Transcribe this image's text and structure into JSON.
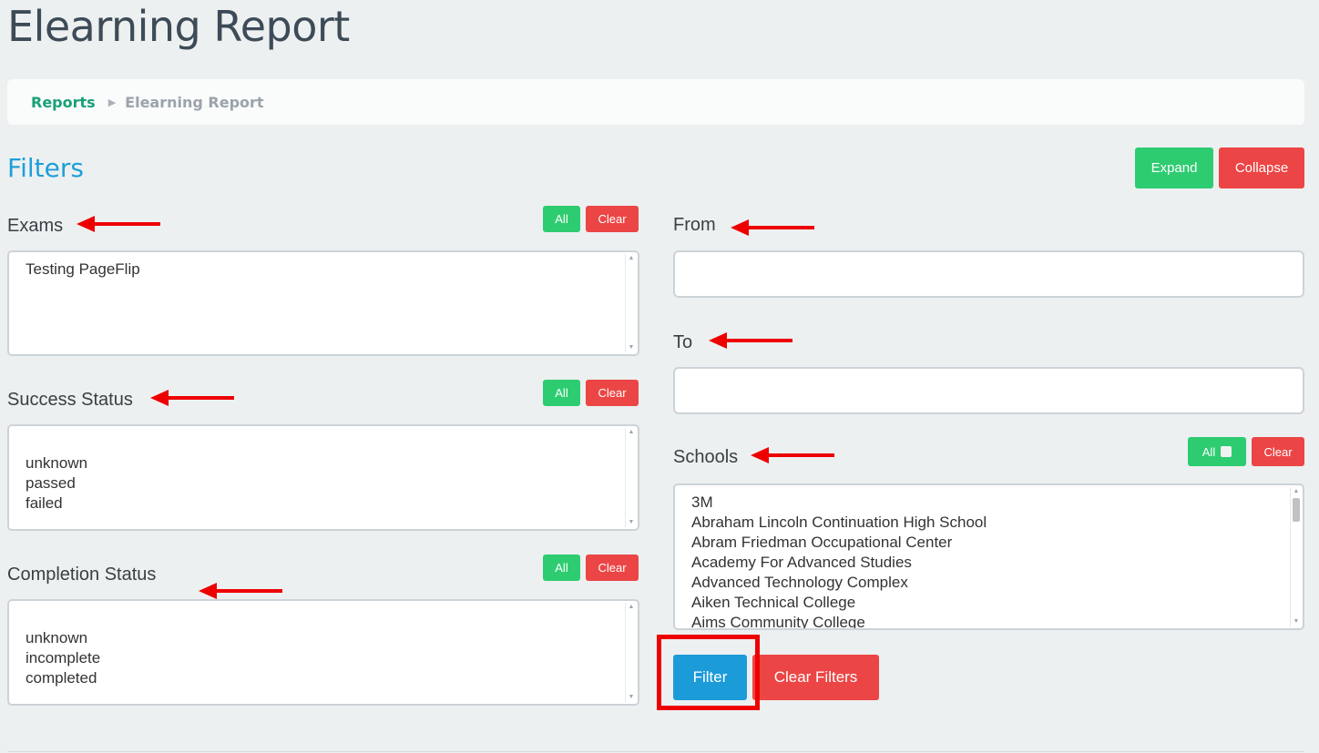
{
  "page": {
    "title": "Elearning Report"
  },
  "breadcrumb": {
    "items": [
      "Reports",
      "Elearning Report"
    ],
    "separator": "▶"
  },
  "filters": {
    "title": "Filters",
    "expand_label": "Expand",
    "collapse_label": "Collapse",
    "exams": {
      "label": "Exams",
      "all_label": "All",
      "clear_label": "Clear",
      "options": [
        "Testing PageFlip"
      ]
    },
    "success_status": {
      "label": "Success Status",
      "all_label": "All",
      "clear_label": "Clear",
      "options": [
        "",
        "unknown",
        "passed",
        "failed"
      ]
    },
    "completion_status": {
      "label": "Completion Status",
      "all_label": "All",
      "clear_label": "Clear",
      "options": [
        "",
        "unknown",
        "incomplete",
        "completed"
      ]
    },
    "from": {
      "label": "From",
      "value": ""
    },
    "to": {
      "label": "To",
      "value": ""
    },
    "schools": {
      "label": "Schools",
      "all_label": "All",
      "clear_label": "Clear",
      "options": [
        "3M",
        "Abraham Lincoln Continuation High School",
        "Abram Friedman Occupational Center",
        "Academy For Advanced Studies",
        "Advanced Technology Complex",
        "Aiken Technical College",
        "Aims Community College"
      ]
    },
    "filter_button": "Filter",
    "clear_filters_button": "Clear Filters"
  },
  "colors": {
    "title": "#3d4b57",
    "accent_blue": "#1e9fd8",
    "green": "#2ecc71",
    "red": "#ec4545",
    "annotation_red": "#ee0000",
    "background": "#edf0f1"
  },
  "icons": [
    "breadcrumb-separator-icon",
    "annotation-arrow-icon",
    "checkbox-icon",
    "scroll-up-icon",
    "scroll-down-icon"
  ]
}
